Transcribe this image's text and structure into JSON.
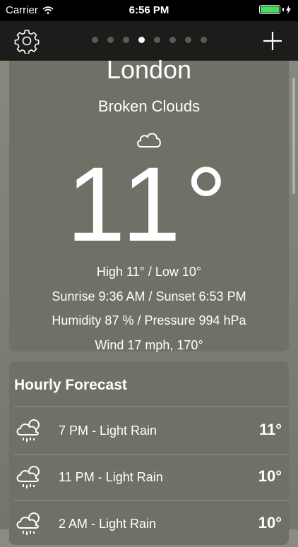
{
  "status_bar": {
    "carrier": "Carrier",
    "time": "6:56 PM",
    "wifi_icon": "wifi-icon",
    "battery_icon": "battery-icon",
    "battery_color": "#4cd964"
  },
  "nav": {
    "settings_icon": "gear-icon",
    "add_icon": "plus-icon",
    "page_count": 8,
    "active_page": 4
  },
  "current": {
    "city": "London",
    "condition": "Broken Clouds",
    "condition_icon": "cloud-icon",
    "temperature": "11°",
    "high_low": "High 11° / Low 10°",
    "sun": "Sunrise 9:36 AM / Sunset 6:53 PM",
    "humidity_pressure": "Humidity 87 % / Pressure 994 hPa",
    "wind": "Wind 17 mph, 170°"
  },
  "hourly": {
    "title": "Hourly Forecast",
    "rows": [
      {
        "label": "7 PM - Light Rain",
        "temp": "11°",
        "icon": "rain-cloud-icon"
      },
      {
        "label": "11 PM - Light Rain",
        "temp": "10°",
        "icon": "rain-cloud-icon"
      },
      {
        "label": "2 AM - Light Rain",
        "temp": "10°",
        "icon": "rain-cloud-icon"
      }
    ]
  }
}
